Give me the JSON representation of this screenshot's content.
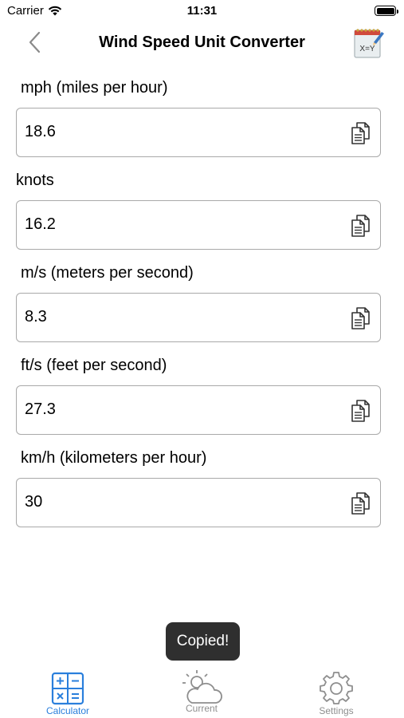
{
  "status_bar": {
    "carrier": "Carrier",
    "time": "11:31"
  },
  "nav": {
    "title": "Wind Speed Unit Converter",
    "app_icon_text": "X=Y"
  },
  "fields": [
    {
      "label": "mph (miles per hour)",
      "value": "18.6"
    },
    {
      "label": "knots",
      "value": "16.2"
    },
    {
      "label": "m/s (meters per second)",
      "value": "8.3"
    },
    {
      "label": "ft/s (feet per second)",
      "value": "27.3"
    },
    {
      "label": "km/h (kilometers per hour)",
      "value": "30"
    }
  ],
  "toast": {
    "text": "Copied!"
  },
  "tab_bar": {
    "tabs": [
      {
        "label": "Calculator",
        "icon": "calculator-icon",
        "active": true
      },
      {
        "label": "Current",
        "icon": "weather-cloud-sun-icon",
        "active": false
      },
      {
        "label": "Settings",
        "icon": "gear-icon",
        "active": false
      }
    ]
  },
  "colors": {
    "accent": "#2a7fdc",
    "inactive": "#8e8e8e",
    "toast_bg": "#2f2f2f",
    "field_border": "#a9a9a9"
  }
}
